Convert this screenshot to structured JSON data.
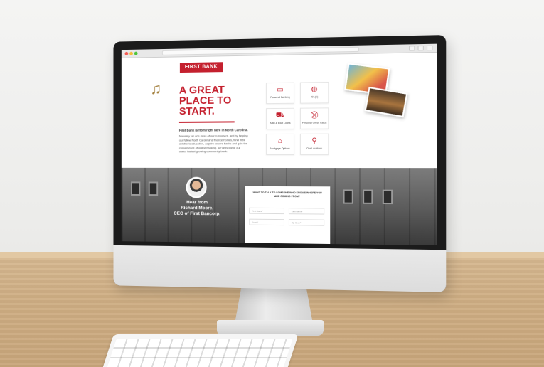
{
  "site": {
    "brand": "FIRST BANK",
    "headline": [
      "A GREAT",
      "PLACE TO",
      "START."
    ],
    "intro_title": "First Bank is from right here in North Carolina.",
    "intro_body": "Naturally, as one more of our customers, and by helping our fellow North Carolinians finance homes, fund their children's education, acquire secure banks and gain the convenience of online banking, we've become our states fastest growing community bank.",
    "colors": {
      "brand": "#c4202e",
      "gold": "#a4813f"
    },
    "tiles": [
      {
        "label": "Personal Banking",
        "icon": "bank-card-icon",
        "glyph": "▭"
      },
      {
        "label": "401(K)",
        "icon": "piggy-icon",
        "glyph": "◍"
      },
      {
        "label": "Auto & Boat Loans",
        "icon": "car-icon",
        "glyph": "⛟"
      },
      {
        "label": "Personal Credit Cards",
        "icon": "cart-icon",
        "glyph": "⛒"
      },
      {
        "label": "Mortgage Options",
        "icon": "home-icon",
        "glyph": "⌂"
      },
      {
        "label": "Our Locations",
        "icon": "map-pin-icon",
        "glyph": "⚲"
      }
    ],
    "hear_from": [
      "Hear from",
      "Richard Moore,",
      "CEO of First Bancorp."
    ],
    "form": {
      "title": "WANT TO TALK TO SOMEONE WHO KNOWS WHERE YOU ARE COMING FROM?",
      "fields": [
        "First Name*",
        "Last Name*",
        "Email*",
        "Zip Code*"
      ]
    }
  }
}
